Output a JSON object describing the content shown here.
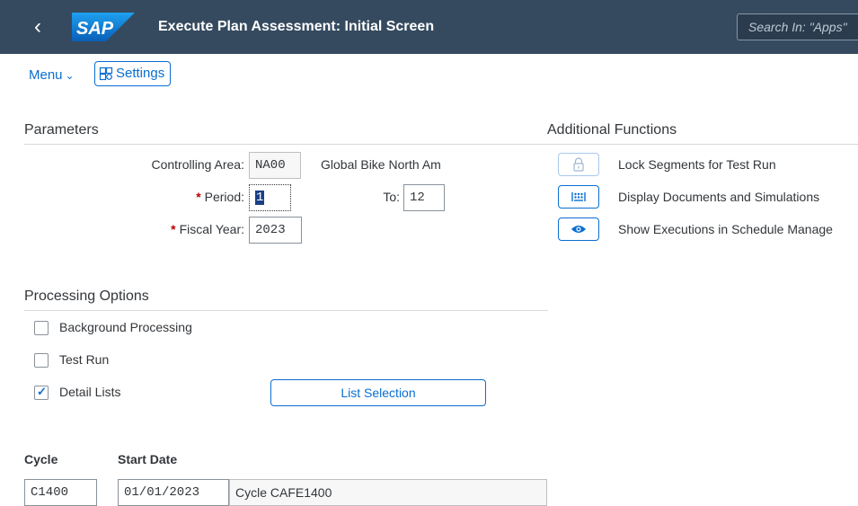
{
  "shell": {
    "title": "Execute Plan Assessment: Initial Screen",
    "logo_text": "SAP",
    "search_placeholder": "Search In: \"Apps\""
  },
  "toolbar": {
    "menu_label": "Menu",
    "settings_label": "Settings"
  },
  "parameters": {
    "title": "Parameters",
    "controlling_area_label": "Controlling Area:",
    "controlling_area_value": "NA00",
    "controlling_area_desc": "Global Bike North Am",
    "period_label": "Period:",
    "period_value": "1",
    "to_label": "To:",
    "to_value": "12",
    "fiscal_year_label": "Fiscal Year:",
    "fiscal_year_value": "2023",
    "required_marker": "*"
  },
  "additional_functions": {
    "title": "Additional Functions",
    "items": [
      {
        "label": "Lock Segments for Test Run",
        "icon": "lock-icon"
      },
      {
        "label": "Display Documents and Simulations",
        "icon": "documents-icon"
      },
      {
        "label": "Show Executions in Schedule Manage",
        "icon": "eye-icon"
      }
    ]
  },
  "processing_options": {
    "title": "Processing Options",
    "background_processing": {
      "label": "Background Processing",
      "checked": false
    },
    "test_run": {
      "label": "Test Run",
      "checked": false
    },
    "detail_lists": {
      "label": "Detail Lists",
      "checked": true
    },
    "list_selection_label": "List Selection"
  },
  "cycle_table": {
    "headers": [
      "Cycle",
      "Start Date"
    ],
    "row": {
      "cycle": "C1400",
      "start_date": "01/01/2023",
      "description": "Cycle CAFE1400"
    }
  },
  "colors": {
    "shell_bg": "#354a5f",
    "accent": "#0a6ed1",
    "required": "#bb0000"
  }
}
